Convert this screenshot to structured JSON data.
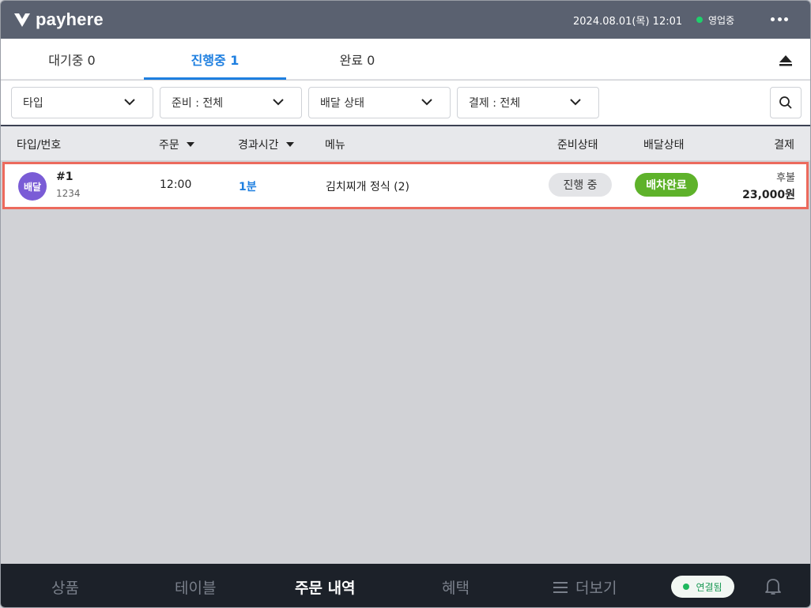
{
  "header": {
    "logo": "payhere",
    "datetime": "2024.08.01(목) 12:01",
    "store_status": "영업중",
    "status_color": "#1fcf6c",
    "more_icon": "more-horizontal-icon"
  },
  "tabs": [
    {
      "label": "대기중 0",
      "active": false
    },
    {
      "label": "진행중 1",
      "active": true
    },
    {
      "label": "완료 0",
      "active": false
    }
  ],
  "call_icon": "service-bell-icon",
  "filters": {
    "type": "타입",
    "prep": "준비 : 전체",
    "delivery": "배달 상태",
    "payment": "결제 : 전체",
    "search_icon": "search-icon"
  },
  "table": {
    "headers": {
      "type_no": "타입/번호",
      "order": "주문",
      "elapsed": "경과시간",
      "menu": "메뉴",
      "prep_status": "준비상태",
      "delivery_status": "배달상태",
      "payment": "결제"
    },
    "rows": [
      {
        "type": "배달",
        "number": "#1",
        "sub": "1234",
        "order_time": "12:00",
        "elapsed": "1분",
        "menu": "김치찌개 정식 (2)",
        "prep_status": "진행 중",
        "delivery_status": "배차완료",
        "pay_type": "후불",
        "amount": "23,000원"
      }
    ]
  },
  "colors": {
    "accent": "#1e7fe0",
    "type_badge": "#7a5cd6",
    "delivery_badge": "#5eb22a",
    "row_highlight": "#ec6a5d"
  },
  "bottom_nav": {
    "products": "상품",
    "tables": "테이블",
    "orders": "주문 내역",
    "benefits": "혜택",
    "more": "더보기",
    "connected": "연결됨",
    "active": "주문 내역"
  }
}
